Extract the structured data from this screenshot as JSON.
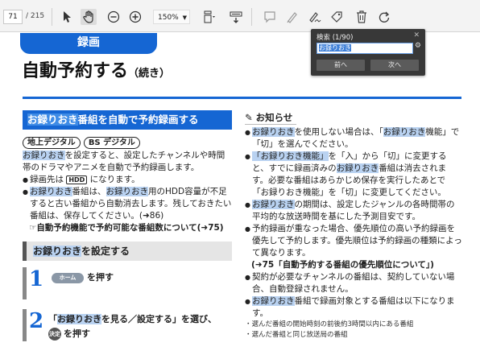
{
  "toolbar": {
    "page_current": "71",
    "page_total": "/ 215",
    "zoom": "150%",
    "icons": [
      "pointer-icon",
      "hand-icon",
      "zoom-out-icon",
      "zoom-in-icon",
      "fit-page-icon",
      "scroll-mode-icon",
      "comment-icon",
      "highlight-icon",
      "sign-icon",
      "edit-icon",
      "delete-icon",
      "redo-icon"
    ]
  },
  "find": {
    "title": "検索 (1/90)",
    "query": "お録りおき",
    "prev_label": "前へ",
    "next_label": "次へ"
  },
  "page": {
    "category": "録画",
    "title": "自動予約する",
    "title_sub": "（続き）",
    "left": {
      "section_hl": "お録りおき",
      "section_rest": "番組を自動で予約録画する",
      "pill1": "地上デジタル",
      "pill2": "BS デジタル",
      "intro_hl": "お録りおき",
      "intro_rest": "を設定すると、設定したチャンネルや時間帯のドラマやアニメを自動で予約録画します。",
      "b1_pre": "録画先は",
      "b1_hdd": "HDD",
      "b1_post": "になります。",
      "b2_hl1": "お録りおき",
      "b2_mid1": "番組は、",
      "b2_hl2": "お録りおき",
      "b2_rest": "用のHDD容量が不足すると古い番組から自動消去します。残しておきたい番組は、保存してください。(➜86)",
      "ref": "☞自動予約機能で予約可能な番組数について(➜75)",
      "graybar_hl": "お録りおき",
      "graybar_rest": "を設定する",
      "step1_num": "1",
      "step1_btn": "ホーム",
      "step1_text": "を押す",
      "step2_num": "2",
      "step2_text_a": "「",
      "step2_hl": "お録りおき",
      "step2_text_b": "を見る／設定する」を選び、",
      "step2_btn": "決定",
      "step2_text_c": "を押す"
    },
    "right": {
      "notice": "お知らせ",
      "items": [
        {
          "hl": "お録りおき",
          "rest": "を使用しない場合は、「",
          "hl2": "お録りおき",
          "rest2": "機能」で「切」を選んでください。"
        },
        {
          "hl": "「お録りおき機能」",
          "rest": "を「入」から「切」に変更すると、すでに録画済みの",
          "hl2": "お録りおき",
          "rest2": "番組は消去されます。必要な番組はあらかじめ保存を実行したあとで「お録りおき機能」を「切」に変更してください。"
        },
        {
          "hl": "お録りおき",
          "rest": "の期間は、設定したジャンルの各時間帯の平均的な放送時間を基にした予測目安です。",
          "hl2": "",
          "rest2": ""
        },
        {
          "hl": "",
          "rest": "予約録画が重なった場合、優先順位の高い予約録画を優先して予約します。優先順位は予約録画の種類によって異なります。",
          "hl2": "",
          "rest2": ""
        }
      ],
      "ref": "(➜75「自動予約する番組の優先順位について」)",
      "items2": [
        {
          "hl": "",
          "rest": "契約が必要なチャンネルの番組は、契約していない場合、自動登録されません。"
        },
        {
          "hl": "お録りおき",
          "rest": "番組で録画対象とする番組は以下になります。"
        }
      ],
      "small1": "・選んだ番組の開始時刻の前後約3時間以内にある番組",
      "small2": "・選んだ番組と同じ放送局の番組"
    }
  }
}
